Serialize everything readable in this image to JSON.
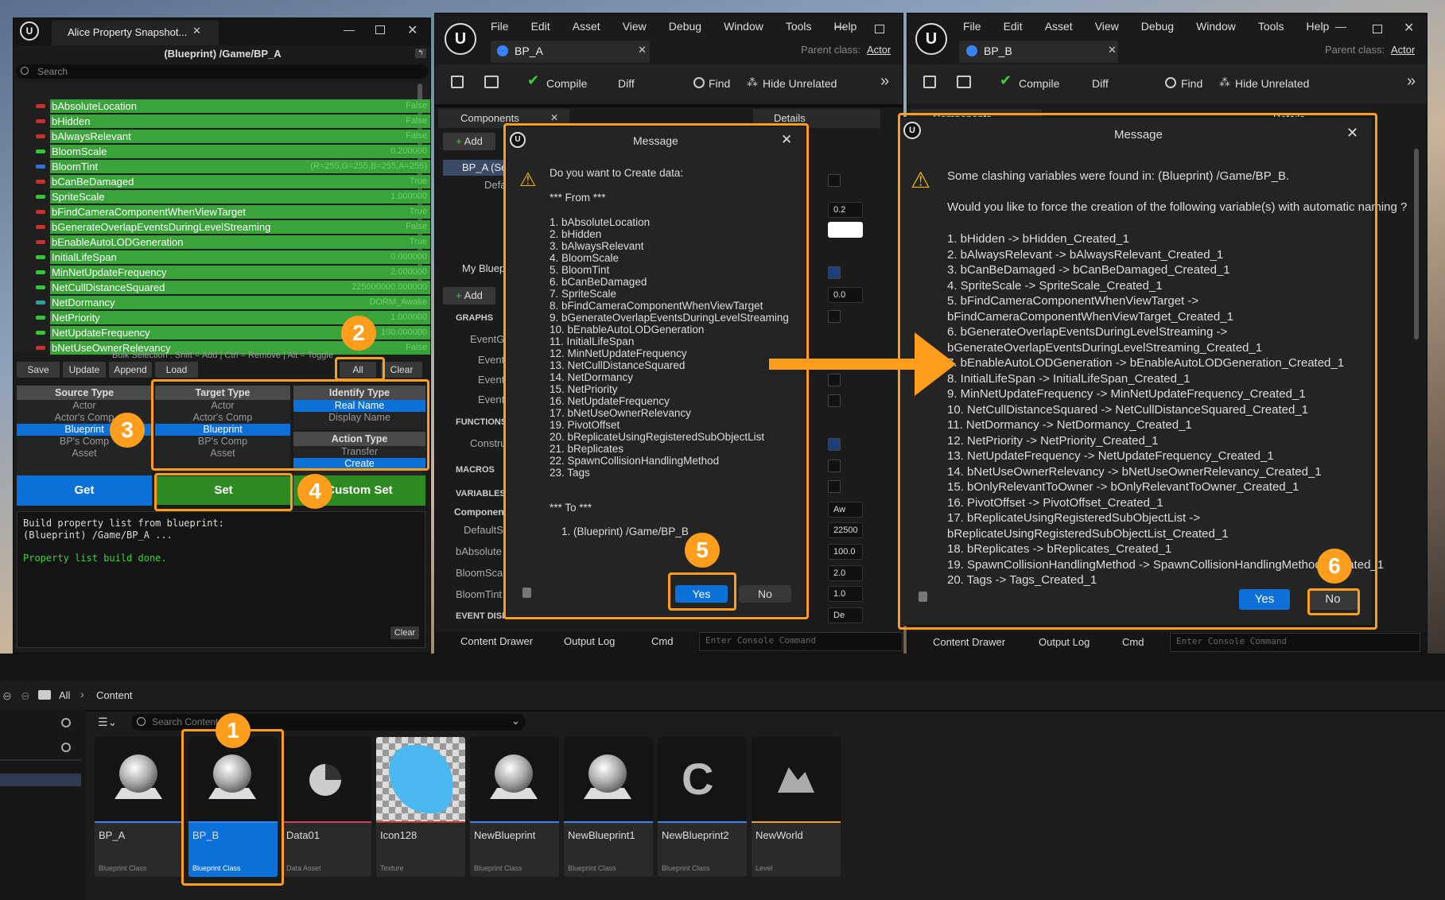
{
  "left_window": {
    "title": "Alice Property Snapshot...",
    "path": "(Blueprint) /Game/BP_A",
    "search_placeholder": "Search",
    "rows": [
      {
        "name": "bAbsoluteLocation",
        "value": "False"
      },
      {
        "name": "bHidden",
        "value": "False"
      },
      {
        "name": "bAlwaysRelevant",
        "value": "False"
      },
      {
        "name": "BloomScale",
        "value": "0.200000"
      },
      {
        "name": "BloomTint",
        "value": "(R=255,G=255,B=255,A=255)"
      },
      {
        "name": "bCanBeDamaged",
        "value": "True"
      },
      {
        "name": "SpriteScale",
        "value": "1.000000"
      },
      {
        "name": "bFindCameraComponentWhenViewTarget",
        "value": "True"
      },
      {
        "name": "bGenerateOverlapEventsDuringLevelStreaming",
        "value": "False"
      },
      {
        "name": "bEnableAutoLODGeneration",
        "value": "True"
      },
      {
        "name": "InitialLifeSpan",
        "value": "0.000000"
      },
      {
        "name": "MinNetUpdateFrequency",
        "value": "2.000000"
      },
      {
        "name": "NetCullDistanceSquared",
        "value": "225000000.000000"
      },
      {
        "name": "NetDormancy",
        "value": "DORM_Awake"
      },
      {
        "name": "NetPriority",
        "value": "1.000000"
      },
      {
        "name": "NetUpdateFrequency",
        "value": "100.000000"
      },
      {
        "name": "bNetUseOwnerRelevancy",
        "value": "False"
      }
    ],
    "bulk_hint": "Bulk Selection : Shift = Add | Ctrl = Remove | Alt = Toggle",
    "buttons": {
      "save": "Save",
      "update": "Update",
      "append": "Append",
      "load": "Load",
      "all": "All",
      "clear": "Clear"
    },
    "source_type": {
      "header": "Source Type",
      "items": [
        "Actor",
        "Actor's Comp",
        "Blueprint",
        "BP's Comp",
        "Asset"
      ]
    },
    "target_type": {
      "header": "Target Type",
      "items": [
        "Actor",
        "Actor's Comp",
        "Blueprint",
        "BP's Comp",
        "Asset"
      ]
    },
    "identify_type": {
      "header": "Identify Type",
      "items": [
        "Real Name",
        "Display Name"
      ]
    },
    "action_type": {
      "header": "Action Type",
      "items": [
        "Transfer",
        "Create"
      ]
    },
    "get": "Get",
    "set": "Set",
    "custom_set": "Custom Set",
    "log": [
      "Build property list from blueprint:",
      "(Blueprint) /Game/BP_A ...",
      "Property list build done."
    ],
    "log_clear": "Clear"
  },
  "bp_a": {
    "menu": [
      "File",
      "Edit",
      "Asset",
      "View",
      "Debug",
      "Window",
      "Tools",
      "Help"
    ],
    "tab": "BP_A",
    "parent_label": "Parent class:",
    "parent_value": "Actor",
    "toolbar": {
      "compile": "Compile",
      "diff": "Diff",
      "find": "Find",
      "hide_unrelated": "Hide Unrelated"
    },
    "components": "Components",
    "details": "Details",
    "add": "Add",
    "tree": [
      "BP_A (Se",
      "Defa"
    ],
    "my_blueprint": "My Bluep",
    "sections": {
      "graphs": "GRAPHS",
      "eventgraph": "EventG",
      "events": [
        "Event",
        "Event",
        "Event"
      ],
      "functions": "FUNCTIONS",
      "construct": "Constru",
      "macros": "MACROS",
      "variables": "VARIABLES",
      "components": "Component",
      "vars": [
        "DefaultS",
        "bAbsolute",
        "BloomScal",
        "BloomTint"
      ],
      "event_disp": "EVENT DISP"
    },
    "detail_values": [
      "0.2",
      "0.0",
      "Aw",
      "22500",
      "100.0",
      "2.0",
      "1.0",
      "De"
    ],
    "bottom": {
      "content_drawer": "Content Drawer",
      "output_log": "Output Log",
      "cmd": "Cmd",
      "console_placeholder": "Enter Console Command"
    }
  },
  "dialog1": {
    "title": "Message",
    "question": "Do you want to Create data:",
    "from": "*** From ***",
    "items": [
      "1.  bAbsoluteLocation",
      "2.  bHidden",
      "3.  bAlwaysRelevant",
      "4.  BloomScale",
      "5.  BloomTint",
      "6.  bCanBeDamaged",
      "7.  SpriteScale",
      "8.  bFindCameraComponentWhenViewTarget",
      "9.  bGenerateOverlapEventsDuringLevelStreaming",
      "10.  bEnableAutoLODGeneration",
      "11.  InitialLifeSpan",
      "12.  MinNetUpdateFrequency",
      "13.  NetCullDistanceSquared",
      "14.  NetDormancy",
      "15.  NetPriority",
      "16.  NetUpdateFrequency",
      "17.  bNetUseOwnerRelevancy",
      "19.  PivotOffset",
      "20.  bReplicateUsingRegisteredSubObjectList",
      "21.  bReplicates",
      "22.  SpawnCollisionHandlingMethod",
      "23.  Tags"
    ],
    "to": "*** To ***",
    "target": "1.  (Blueprint) /Game/BP_B",
    "yes": "Yes",
    "no": "No"
  },
  "bp_b": {
    "menu": [
      "File",
      "Edit",
      "Asset",
      "View",
      "Debug",
      "Window",
      "Tools",
      "Help"
    ],
    "tab": "BP_B",
    "parent_label": "Parent class:",
    "parent_value": "Actor",
    "toolbar": {
      "compile": "Compile",
      "diff": "Diff",
      "find": "Find",
      "hide_unrelated": "Hide Unrelated"
    },
    "components": "Components",
    "details": "Details",
    "bottom": {
      "content_drawer": "Content Drawer",
      "output_log": "Output Log",
      "cmd": "Cmd",
      "console_placeholder": "Enter Console Command"
    }
  },
  "dialog2": {
    "title": "Message",
    "line1": "Some clashing variables were found in: (Blueprint) /Game/BP_B.",
    "line2": "Would you like to force the creation of the following variable(s) with automatic naming ?",
    "items": [
      "1.  bHidden  ->  bHidden_Created_1",
      "2.  bAlwaysRelevant  ->  bAlwaysRelevant_Created_1",
      "3.  bCanBeDamaged  ->  bCanBeDamaged_Created_1",
      "4.  SpriteScale  ->  SpriteScale_Created_1",
      "5.  bFindCameraComponentWhenViewTarget  ->",
      "bFindCameraComponentWhenViewTarget_Created_1",
      "6.  bGenerateOverlapEventsDuringLevelStreaming  ->",
      "bGenerateOverlapEventsDuringLevelStreaming_Created_1",
      "7.  bEnableAutoLODGeneration  ->  bEnableAutoLODGeneration_Created_1",
      "8.  InitialLifeSpan  ->  InitialLifeSpan_Created_1",
      "9.  MinNetUpdateFrequency  ->  MinNetUpdateFrequency_Created_1",
      "10.  NetCullDistanceSquared  ->  NetCullDistanceSquared_Created_1",
      "11.  NetDormancy  ->  NetDormancy_Created_1",
      "12.  NetPriority  ->  NetPriority_Created_1",
      "13.  NetUpdateFrequency  ->  NetUpdateFrequency_Created_1",
      "14.  bNetUseOwnerRelevancy  ->  bNetUseOwnerRelevancy_Created_1",
      "15.  bOnlyRelevantToOwner  ->  bOnlyRelevantToOwner_Created_1",
      "16.  PivotOffset  ->  PivotOffset_Created_1",
      "17.  bReplicateUsingRegisteredSubObjectList  ->",
      "bReplicateUsingRegisteredSubObjectList_Created_1",
      "18.  bReplicates  ->  bReplicates_Created_1",
      "19.  SpawnCollisionHandlingMethod  ->  SpawnCollisionHandlingMethod_Created_1",
      "20.  Tags  ->  Tags_Created_1"
    ],
    "yes": "Yes",
    "no": "No"
  },
  "content_browser": {
    "breadcrumb": [
      "All",
      "Content"
    ],
    "search_placeholder": "Search Content",
    "assets": [
      {
        "name": "BP_A",
        "type": "Blueprint Class",
        "color": "#3b82f6"
      },
      {
        "name": "BP_B",
        "type": "Blueprint Class",
        "color": "#3b82f6"
      },
      {
        "name": "Data01",
        "type": "Data Asset",
        "color": "#d0405a"
      },
      {
        "name": "Icon128",
        "type": "Texture",
        "color": "#c0392b"
      },
      {
        "name": "NewBlueprint",
        "type": "Blueprint Class",
        "color": "#3b82f6"
      },
      {
        "name": "NewBlueprint1",
        "type": "Blueprint Class",
        "color": "#3b82f6"
      },
      {
        "name": "NewBlueprint2",
        "type": "Blueprint Class",
        "color": "#3b82f6"
      },
      {
        "name": "NewWorld",
        "type": "Level",
        "color": "#f0a020"
      }
    ]
  },
  "badges": [
    "1",
    "2",
    "3",
    "4",
    "5",
    "6"
  ],
  "colors": {
    "accent": "#ff9d1c",
    "select": "#0b70d8",
    "row_green": "#3aa33a"
  }
}
